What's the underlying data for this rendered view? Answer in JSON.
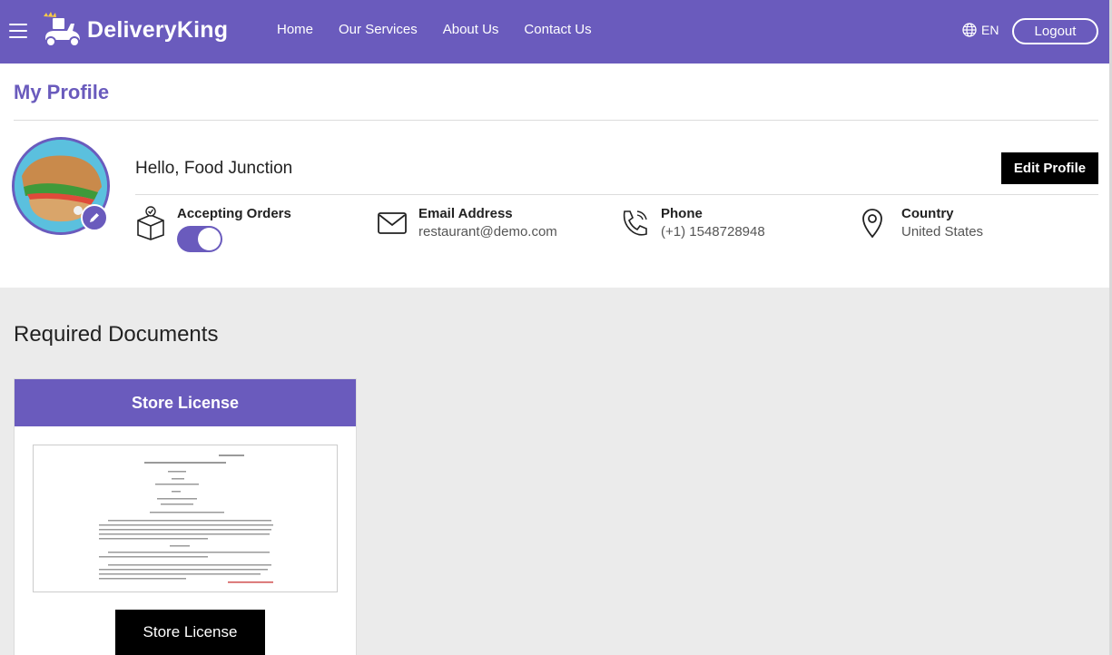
{
  "header": {
    "brand": "DeliveryKing",
    "nav": [
      "Home",
      "Our Services",
      "About Us",
      "Contact Us"
    ],
    "language": "EN",
    "logout_label": "Logout"
  },
  "profile": {
    "page_title": "My Profile",
    "greeting": "Hello, Food Junction",
    "edit_label": "Edit Profile",
    "accepting_orders": {
      "label": "Accepting Orders",
      "enabled": true
    },
    "email": {
      "label": "Email Address",
      "value": "restaurant@demo.com"
    },
    "phone": {
      "label": "Phone",
      "value": "(+1) 1548728948"
    },
    "country": {
      "label": "Country",
      "value": "United States"
    }
  },
  "documents": {
    "title": "Required Documents",
    "cards": [
      {
        "title": "Store License",
        "button_label": "Store License"
      }
    ]
  },
  "colors": {
    "primary": "#6a5bbd",
    "background": "#ebebeb",
    "button": "#000000"
  }
}
